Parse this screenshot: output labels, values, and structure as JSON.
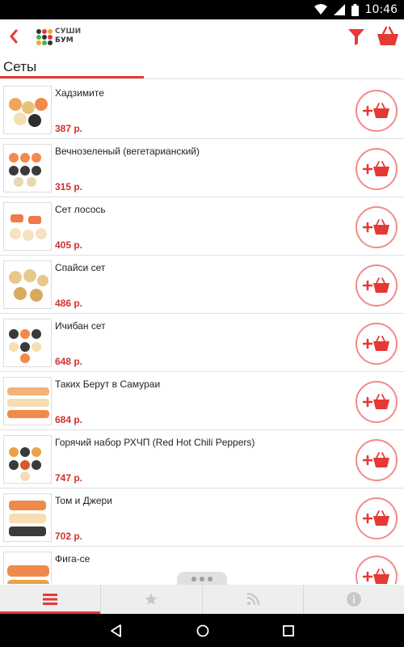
{
  "status_bar": {
    "time": "10:46"
  },
  "app": {
    "logo_line1": "СУШИ",
    "logo_line2": "БУМ"
  },
  "section": {
    "title": "Сеты"
  },
  "items": [
    {
      "name": "Хадзимите",
      "price": "387 р."
    },
    {
      "name": "Вечнозеленый (вегетарианский)",
      "price": "315 р."
    },
    {
      "name": "Сет лосось",
      "price": "405 р."
    },
    {
      "name": "Спайси сет",
      "price": "486 р."
    },
    {
      "name": "Ичибан сет",
      "price": "648 р."
    },
    {
      "name": "Таких Берут в Самураи",
      "price": "684 р."
    },
    {
      "name": "Горячий набор РХЧП (Red Hot Chili Peppers)",
      "price": "747 р."
    },
    {
      "name": "Том и Джери",
      "price": "702 р."
    },
    {
      "name": "Фига-се",
      "price": ""
    }
  ],
  "tabs": [
    {
      "icon": "menu-icon",
      "active": true
    },
    {
      "icon": "star-icon",
      "active": false
    },
    {
      "icon": "rss-icon",
      "active": false
    },
    {
      "icon": "info-icon",
      "active": false
    }
  ],
  "colors": {
    "accent": "#e53935",
    "price": "#d32f2f",
    "button_ring": "#f28b8b"
  }
}
